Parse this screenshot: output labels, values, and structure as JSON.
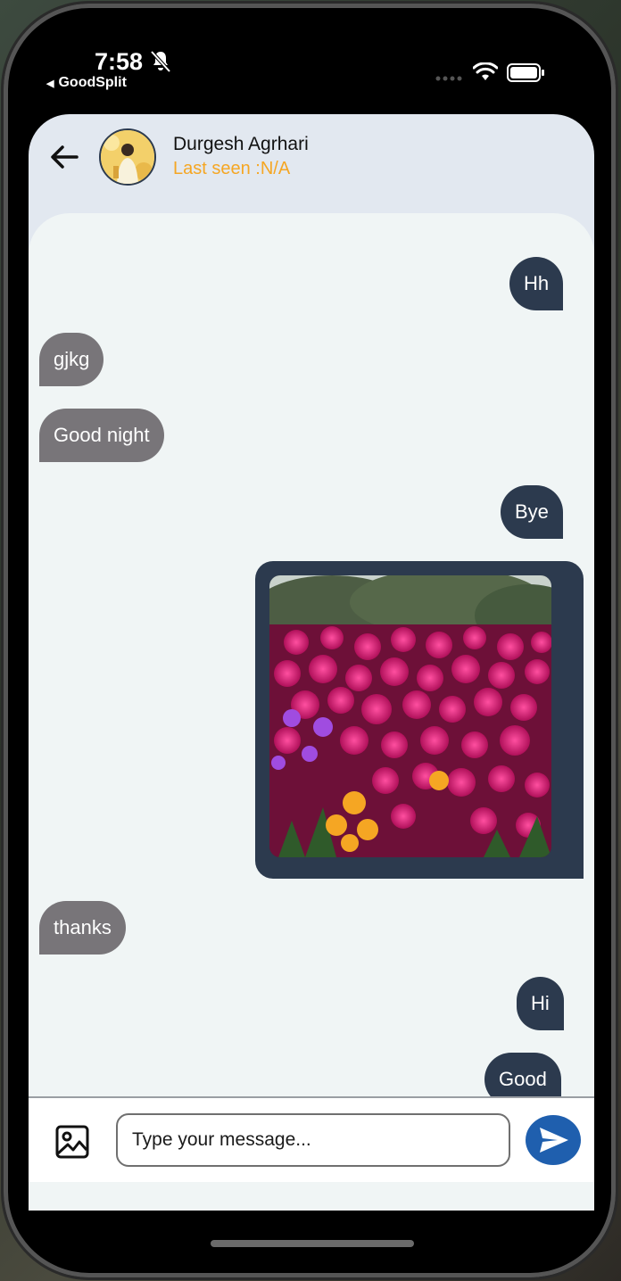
{
  "status_bar": {
    "time": "7:58",
    "back_app_label": "GoodSplit",
    "icons": [
      "bell-off-icon",
      "signal-dots",
      "wifi-icon",
      "battery-icon"
    ]
  },
  "header": {
    "contact_name": "Durgesh Agrhari",
    "last_seen": "Last seen :N/A",
    "back_icon": "arrow-left-icon"
  },
  "messages": [
    {
      "direction": "out",
      "text": "Hh"
    },
    {
      "direction": "in",
      "text": "gjkg"
    },
    {
      "direction": "in",
      "text": "Good night"
    },
    {
      "direction": "out",
      "text": "Bye"
    },
    {
      "direction": "out",
      "type": "image",
      "description_icon": "flower-photo"
    },
    {
      "direction": "in",
      "text": "thanks"
    },
    {
      "direction": "out",
      "text": "Hi"
    },
    {
      "direction": "out",
      "text": "Good"
    }
  ],
  "composer": {
    "placeholder": "Type your message...",
    "value": "",
    "gallery_icon": "image-icon",
    "send_icon": "send-icon"
  },
  "colors": {
    "outgoing_bubble": "#2c3a4e",
    "incoming_bubble": "#787579",
    "last_seen": "#f5a623",
    "send_button": "#1f5fae",
    "chat_background": "#f0f5f5",
    "header_background": "#e2e8f0"
  }
}
